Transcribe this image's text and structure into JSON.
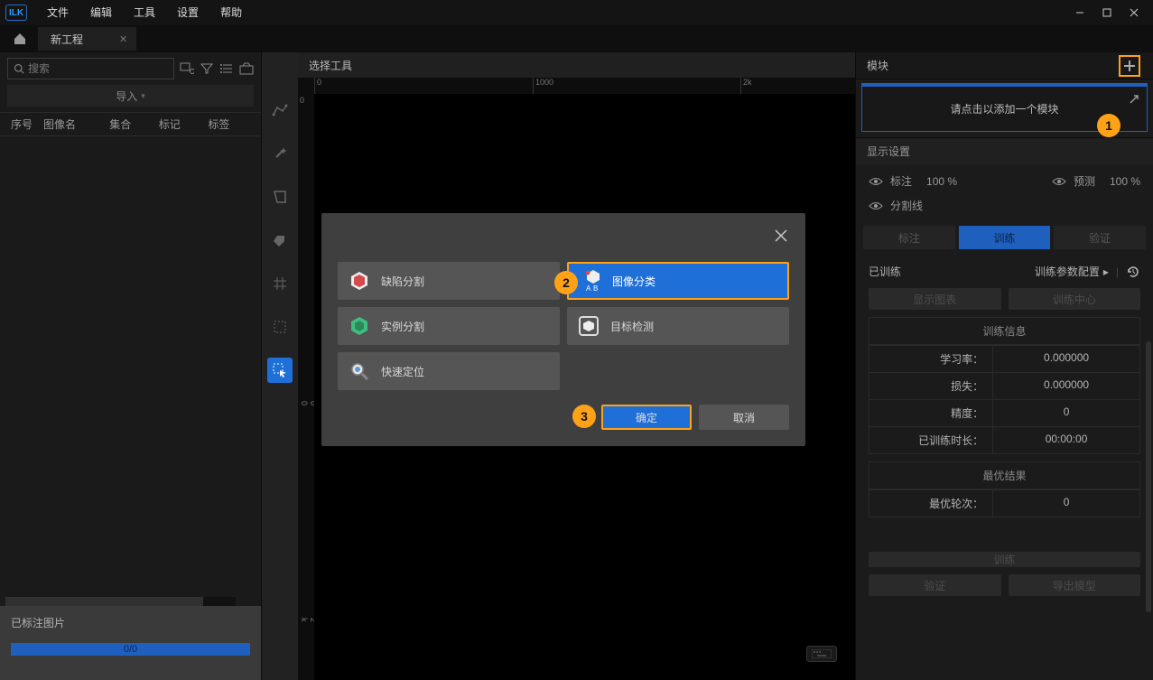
{
  "menubar": {
    "logo": "ILK",
    "items": [
      "文件",
      "编辑",
      "工具",
      "设置",
      "帮助"
    ]
  },
  "tab": {
    "title": "新工程"
  },
  "left_panel": {
    "search_placeholder": "搜索",
    "import_label": "导入",
    "columns": [
      "序号",
      "图像名",
      "集合",
      "标记",
      "标签"
    ],
    "annotated_label": "已标注图片",
    "progress_text": "0/0"
  },
  "canvas": {
    "header": "选择工具",
    "ruler_ticks": [
      "0",
      "1000",
      "2k"
    ],
    "v_ruler_ticks": [
      "0",
      "1000",
      "2k"
    ]
  },
  "right_panel": {
    "module_title": "模块",
    "module_placeholder": "请点击以添加一个模块",
    "display_title": "显示设置",
    "annotation_label": "标注",
    "annotation_value": "100 %",
    "predict_label": "预测",
    "predict_value": "100 %",
    "seg_label": "分割线",
    "tabs": [
      "标注",
      "训练",
      "验证"
    ],
    "trained_label": "已训练",
    "train_params_label": "训练参数配置",
    "buttons": [
      "显示图表",
      "训练中心"
    ],
    "info_title": "训练信息",
    "info_rows": [
      [
        "学习率：",
        "0.000000"
      ],
      [
        "损失：",
        "0.000000"
      ],
      [
        "精度：",
        "0"
      ],
      [
        "已训练时长：",
        "00:00:00"
      ]
    ],
    "best_title": "最优结果",
    "best_rows": [
      [
        "最优轮次：",
        "0"
      ]
    ],
    "foot1": "训练",
    "foot2a": "验证",
    "foot2b": "导出模型"
  },
  "modal": {
    "options": [
      {
        "label": "缺陷分割",
        "selected": false
      },
      {
        "label": "图像分类",
        "selected": true
      },
      {
        "label": "实例分割",
        "selected": false
      },
      {
        "label": "目标检测",
        "selected": false
      },
      {
        "label": "快速定位",
        "selected": false
      }
    ],
    "ok": "确定",
    "cancel": "取消"
  },
  "steps": {
    "s1": "1",
    "s2": "2",
    "s3": "3"
  }
}
